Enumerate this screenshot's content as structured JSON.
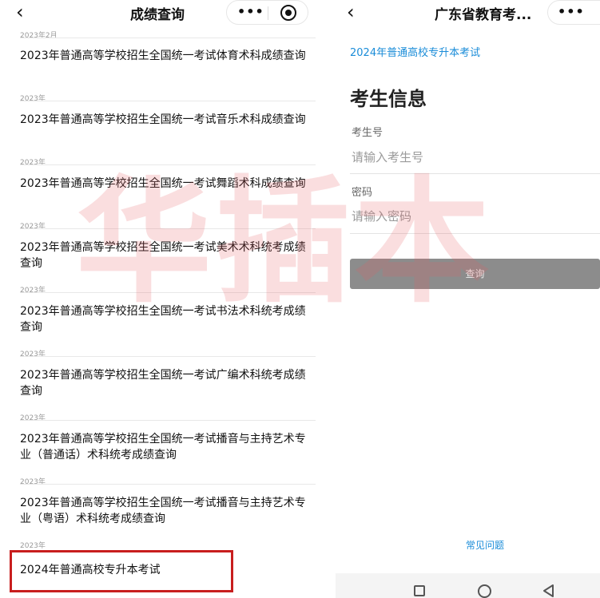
{
  "left_panel": {
    "title": "成绩查询",
    "back_icon": "chevron-left-icon",
    "top_date": "2023年2月",
    "items": [
      {
        "date": "2023年",
        "title": "2023年普通高等学校招生全国统一考试体育术科成绩查询"
      },
      {
        "date": "2023年",
        "title": "2023年普通高等学校招生全国统一考试音乐术科成绩查询"
      },
      {
        "date": "2023年",
        "title": "2023年普通高等学校招生全国统一考试舞蹈术科成绩查询"
      },
      {
        "date": "2023年",
        "title": "2023年普通高等学校招生全国统一考试美术术科统考成绩查询"
      },
      {
        "date": "2023年",
        "title": "2023年普通高等学校招生全国统一考试书法术科统考成绩查询"
      },
      {
        "date": "2023年",
        "title": "2023年普通高等学校招生全国统一考试广编术科统考成绩查询"
      },
      {
        "date": "2023年",
        "title": "2023年普通高等学校招生全国统一考试播音与主持艺术专业（普通话）术科统考成绩查询"
      },
      {
        "date": "2023年",
        "title": "2023年普通高等学校招生全国统一考试播音与主持艺术专业（粤语）术科统考成绩查询"
      }
    ],
    "highlighted_item": {
      "date": "2023年",
      "title": "2024年普通高校专升本考试"
    },
    "highlight_color": "#c81e1e"
  },
  "right_panel": {
    "title": "广东省教育考...",
    "exam_name": "2024年普通高校专升本考试",
    "heading": "考生信息",
    "fields": [
      {
        "label": "考生号",
        "placeholder": "请输入考生号"
      },
      {
        "label": "密码",
        "placeholder": "请输入密码"
      }
    ],
    "query_button": "查询",
    "faq_link": "常见问题",
    "link_color": "#1a8cd8"
  },
  "capsule": {
    "more_icon": "more-dots-icon",
    "close_icon": "target-circle-icon"
  },
  "system_nav": {
    "icons": [
      "square-icon",
      "circle-home-icon",
      "triangle-back-icon"
    ]
  },
  "watermark": "华插本"
}
